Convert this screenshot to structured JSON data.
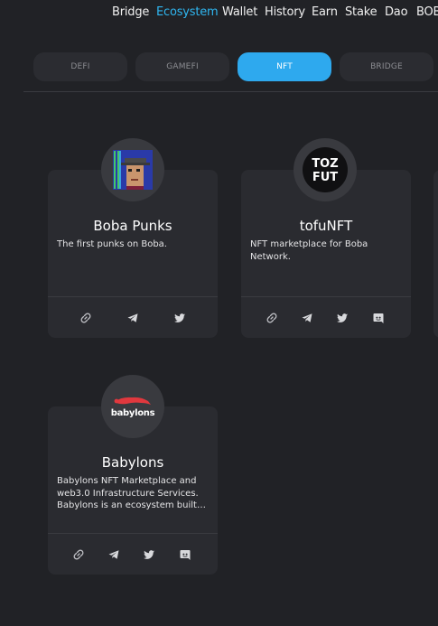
{
  "nav": {
    "items": [
      {
        "label": "Bridge",
        "active": false
      },
      {
        "label": "Ecosystem",
        "active": true
      },
      {
        "label": "Wallet",
        "active": false
      },
      {
        "label": "History",
        "active": false
      },
      {
        "label": "Earn",
        "active": false
      },
      {
        "label": "Stake",
        "active": false
      },
      {
        "label": "Dao",
        "active": false
      },
      {
        "label": "BOBA",
        "active": false
      }
    ]
  },
  "tabs": [
    {
      "label": "DEFI",
      "active": false
    },
    {
      "label": "GAMEFI",
      "active": false
    },
    {
      "label": "NFT",
      "active": true
    },
    {
      "label": "BRIDGE",
      "active": false
    }
  ],
  "projects": [
    {
      "title": "Boba Punks",
      "description": "The first punks on Boba.",
      "icons": [
        "link-icon",
        "telegram-icon",
        "twitter-icon"
      ]
    },
    {
      "title": "tofuNFT",
      "description": "NFT marketplace for Boba Network.",
      "logo_text": [
        "TOZ",
        "FUT"
      ],
      "icons": [
        "link-icon",
        "telegram-icon",
        "twitter-icon",
        "discord-icon"
      ]
    },
    {
      "title": "Babylons",
      "description": "Babylons NFT Marketplace and web3.0 Infrastructure Services. Babylons is an ecosystem built on blockchain technology.",
      "logo_text": "babylons",
      "icons": [
        "link-icon",
        "telegram-icon",
        "twitter-icon",
        "discord-icon"
      ]
    }
  ],
  "colors": {
    "background": "#212226",
    "card": "#2a2b30",
    "accent": "#2ea9ee",
    "nav_active": "#2fb6f0"
  }
}
